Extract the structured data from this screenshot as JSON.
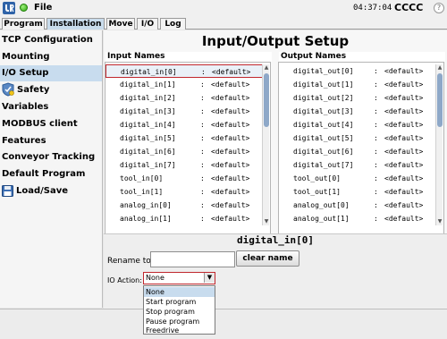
{
  "titlebar": {
    "file_label": "File",
    "clock": "04:37:04",
    "robot_name": "CCCC"
  },
  "tabs": [
    {
      "label": "Program",
      "active": false
    },
    {
      "label": "Installation",
      "active": true
    },
    {
      "label": "Move",
      "active": false
    },
    {
      "label": "I/O",
      "active": false
    },
    {
      "label": "Log",
      "active": false
    }
  ],
  "sidebar": {
    "items": [
      {
        "label": "TCP Configuration",
        "icon": "none"
      },
      {
        "label": "Mounting",
        "icon": "none"
      },
      {
        "label": "I/O Setup",
        "icon": "none",
        "active": true
      },
      {
        "label": "Safety",
        "icon": "shield-icon"
      },
      {
        "label": "Variables",
        "icon": "none"
      },
      {
        "label": "MODBUS client",
        "icon": "none"
      },
      {
        "label": "Features",
        "icon": "none"
      },
      {
        "label": "Conveyor Tracking",
        "icon": "none"
      },
      {
        "label": "Default Program",
        "icon": "none"
      },
      {
        "label": "Load/Save",
        "icon": "floppy-icon"
      }
    ]
  },
  "main": {
    "title": "Input/Output Setup",
    "inputs": {
      "heading": "Input Names",
      "rows": [
        {
          "name": "digital_in[0]",
          "sep": ":",
          "value": "<default>"
        },
        {
          "name": "digital_in[1]",
          "sep": ":",
          "value": "<default>"
        },
        {
          "name": "digital_in[2]",
          "sep": ":",
          "value": "<default>"
        },
        {
          "name": "digital_in[3]",
          "sep": ":",
          "value": "<default>"
        },
        {
          "name": "digital_in[4]",
          "sep": ":",
          "value": "<default>"
        },
        {
          "name": "digital_in[5]",
          "sep": ":",
          "value": "<default>"
        },
        {
          "name": "digital_in[6]",
          "sep": ":",
          "value": "<default>"
        },
        {
          "name": "digital_in[7]",
          "sep": ":",
          "value": "<default>"
        },
        {
          "name": "tool_in[0]",
          "sep": ":",
          "value": "<default>"
        },
        {
          "name": "tool_in[1]",
          "sep": ":",
          "value": "<default>"
        },
        {
          "name": "analog_in[0]",
          "sep": ":",
          "value": "<default>"
        },
        {
          "name": "analog_in[1]",
          "sep": ":",
          "value": "<default>"
        }
      ]
    },
    "outputs": {
      "heading": "Output Names",
      "rows": [
        {
          "name": "digital_out[0]",
          "sep": ":",
          "value": "<default>"
        },
        {
          "name": "digital_out[1]",
          "sep": ":",
          "value": "<default>"
        },
        {
          "name": "digital_out[2]",
          "sep": ":",
          "value": "<default>"
        },
        {
          "name": "digital_out[3]",
          "sep": ":",
          "value": "<default>"
        },
        {
          "name": "digital_out[4]",
          "sep": ":",
          "value": "<default>"
        },
        {
          "name": "digital_out[5]",
          "sep": ":",
          "value": "<default>"
        },
        {
          "name": "digital_out[6]",
          "sep": ":",
          "value": "<default>"
        },
        {
          "name": "digital_out[7]",
          "sep": ":",
          "value": "<default>"
        },
        {
          "name": "tool_out[0]",
          "sep": ":",
          "value": "<default>"
        },
        {
          "name": "tool_out[1]",
          "sep": ":",
          "value": "<default>"
        },
        {
          "name": "analog_out[0]",
          "sep": ":",
          "value": "<default>"
        },
        {
          "name": "analog_out[1]",
          "sep": ":",
          "value": "<default>"
        }
      ]
    },
    "detail": {
      "title": "digital_in[0]",
      "rename_label": "Rename to",
      "rename_value": "",
      "clear_button": "clear name",
      "io_action_label": "IO Action:",
      "io_action_value": "None",
      "io_action_options": [
        "None",
        "Start program",
        "Stop program",
        "Pause program",
        "Freedrive"
      ]
    }
  },
  "colors": {
    "accent": "#c8dcee",
    "highlight_border": "#c0272d",
    "run_indicator": "#2ea80e"
  }
}
